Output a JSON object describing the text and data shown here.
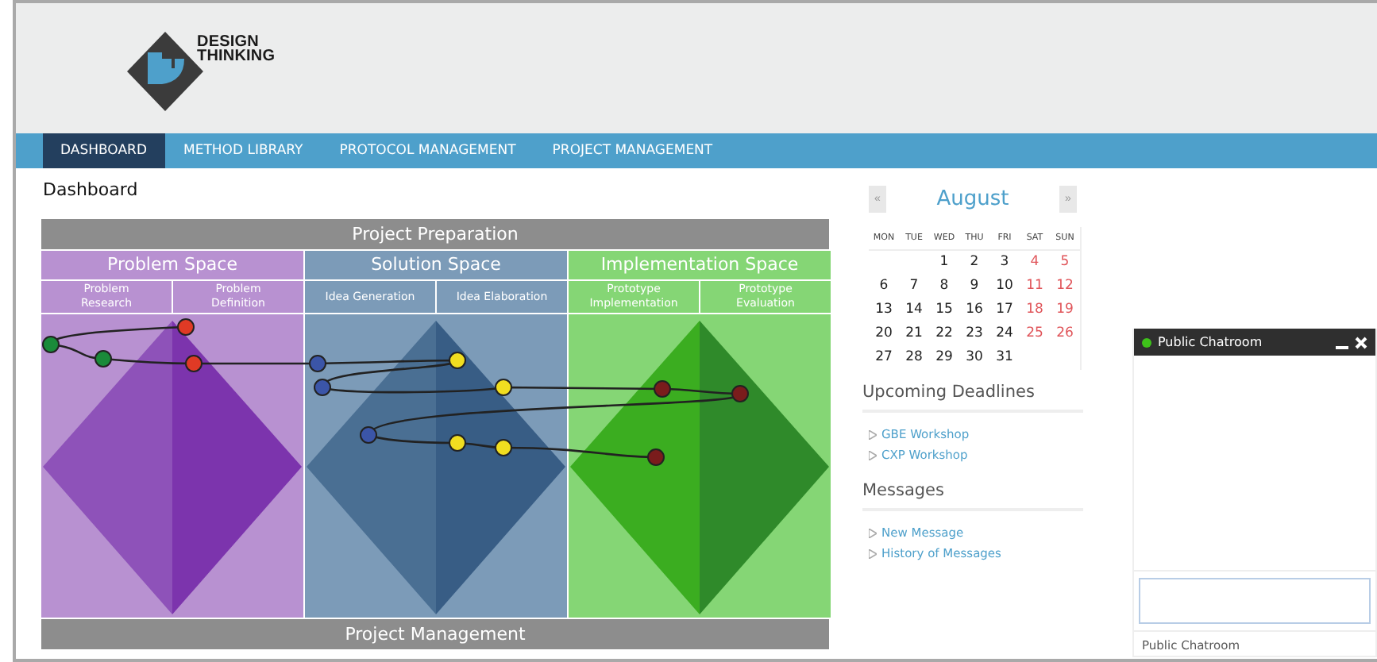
{
  "logo": {
    "line_1": "DESIGN",
    "line_2": "THINKING"
  },
  "nav": [
    {
      "label": "DASHBOARD",
      "selected": true
    },
    {
      "label": "METHOD LIBRARY",
      "selected": false
    },
    {
      "label": "PROTOCOL MANAGEMENT",
      "selected": false
    },
    {
      "label": "PROJECT MANAGEMENT",
      "selected": false
    }
  ],
  "page_title": "Dashboard",
  "diagram": {
    "top_band": "Project Preparation",
    "bottom_band": "Project Management",
    "spaces": [
      {
        "title": "Problem Space",
        "kind": "purple",
        "phases": [
          "Problem Research",
          "Problem Definition"
        ]
      },
      {
        "title": "Solution Space",
        "kind": "blue",
        "phases": [
          "Idea Generation",
          "Idea Elaboration"
        ]
      },
      {
        "title": "Implementation Space",
        "kind": "green",
        "phases": [
          "Prototype Implementation",
          "Prototype Evaluation"
        ]
      }
    ]
  },
  "calendar": {
    "prev": "«",
    "month": "August",
    "next": "»",
    "weekdays": [
      "MON",
      "TUE",
      "WED",
      "THU",
      "FRI",
      "SAT",
      "SUN"
    ],
    "weeks": [
      [
        {
          "kind": "blank"
        },
        {
          "kind": "blank"
        },
        {
          "kind": "day",
          "label": "1",
          "weekend": false
        },
        {
          "kind": "day",
          "label": "2",
          "weekend": false
        },
        {
          "kind": "day",
          "label": "3",
          "weekend": false
        },
        {
          "kind": "day",
          "label": "4",
          "weekend": true
        },
        {
          "kind": "day",
          "label": "5",
          "weekend": true
        }
      ],
      [
        {
          "kind": "day",
          "label": "6",
          "weekend": false
        },
        {
          "kind": "day",
          "label": "7",
          "weekend": false
        },
        {
          "kind": "day",
          "label": "8",
          "weekend": false
        },
        {
          "kind": "day",
          "label": "9",
          "weekend": false
        },
        {
          "kind": "day",
          "label": "10",
          "weekend": false
        },
        {
          "kind": "day",
          "label": "11",
          "weekend": true
        },
        {
          "kind": "day",
          "label": "12",
          "weekend": true
        }
      ],
      [
        {
          "kind": "day",
          "label": "13",
          "weekend": false
        },
        {
          "kind": "day",
          "label": "14",
          "weekend": false
        },
        {
          "kind": "day",
          "label": "15",
          "weekend": false
        },
        {
          "kind": "day",
          "label": "16",
          "weekend": false
        },
        {
          "kind": "day",
          "label": "17",
          "weekend": false
        },
        {
          "kind": "day",
          "label": "18",
          "weekend": true
        },
        {
          "kind": "day",
          "label": "19",
          "weekend": true
        }
      ],
      [
        {
          "kind": "day",
          "label": "20",
          "weekend": false
        },
        {
          "kind": "day",
          "label": "21",
          "weekend": false
        },
        {
          "kind": "day",
          "label": "22",
          "weekend": false
        },
        {
          "kind": "day",
          "label": "23",
          "weekend": false
        },
        {
          "kind": "day",
          "label": "24",
          "weekend": false
        },
        {
          "kind": "day",
          "label": "25",
          "weekend": true
        },
        {
          "kind": "day",
          "label": "26",
          "weekend": true
        }
      ],
      [
        {
          "kind": "day",
          "label": "27",
          "weekend": false
        },
        {
          "kind": "day",
          "label": "28",
          "weekend": false
        },
        {
          "kind": "day",
          "label": "29",
          "weekend": false
        },
        {
          "kind": "day",
          "label": "30",
          "weekend": false
        },
        {
          "kind": "day",
          "label": "31",
          "weekend": false
        }
      ]
    ]
  },
  "sections": [
    {
      "title": "Upcoming Deadlines",
      "links": [
        "GBE Workshop",
        "CXP Workshop"
      ]
    },
    {
      "title": "Messages",
      "links": [
        "New Message",
        "History of Messages"
      ]
    }
  ],
  "chat": {
    "title": "Public Chatroom",
    "online": true,
    "footer": "Public Chatroom"
  }
}
